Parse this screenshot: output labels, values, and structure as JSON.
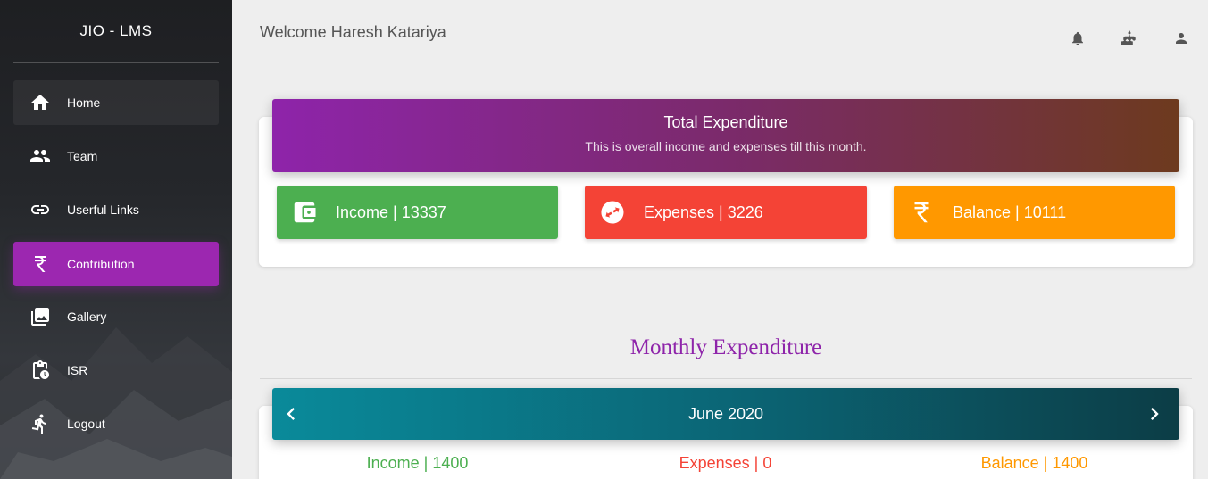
{
  "brand": {
    "title": "JIO - LMS"
  },
  "sidebar": {
    "items": [
      {
        "label": "Home",
        "icon": "home-icon"
      },
      {
        "label": "Team",
        "icon": "group-icon"
      },
      {
        "label": "Userful Links",
        "icon": "link-icon"
      },
      {
        "label": "Contribution",
        "icon": "rupee-icon",
        "active": true
      },
      {
        "label": "Gallery",
        "icon": "gallery-icon"
      },
      {
        "label": "ISR",
        "icon": "clipboard-clock-icon"
      },
      {
        "label": "Logout",
        "icon": "running-person-icon"
      }
    ]
  },
  "header": {
    "welcome": "Welcome Haresh Katariya",
    "icons": [
      "bell-icon",
      "cake-icon",
      "person-icon"
    ]
  },
  "total": {
    "title": "Total Expenditure",
    "subtitle": "This is overall income and expenses till this month.",
    "income": "Income | 13337",
    "expenses": "Expenses | 3226",
    "balance": "Balance | 10111"
  },
  "monthly": {
    "title": "Monthly Expenditure",
    "month": "June 2020",
    "income": "Income | 1400",
    "expenses": "Expenses | 0",
    "balance": "Balance | 1400"
  },
  "colors": {
    "accent": "#9c27b0",
    "income": "#4caf50",
    "expenses": "#f44336",
    "balance": "#ff9800",
    "month_bar": "#0b6676"
  }
}
